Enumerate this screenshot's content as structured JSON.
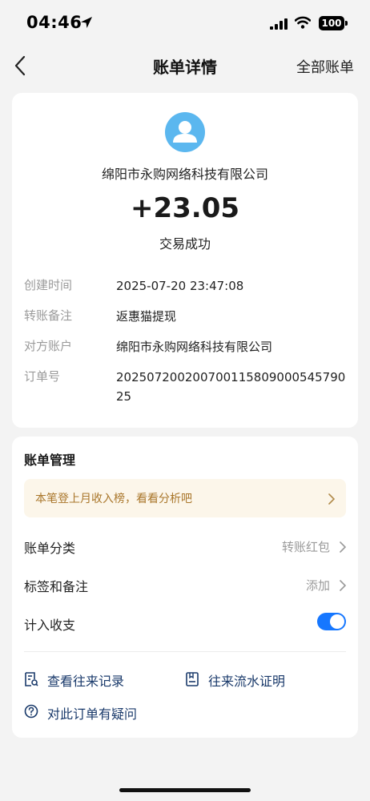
{
  "status_bar": {
    "time": "04:46",
    "battery": "100"
  },
  "nav": {
    "title": "账单详情",
    "right_label": "全部账单"
  },
  "summary": {
    "merchant": "绵阳市永购网络科技有限公司",
    "amount": "+23.05",
    "status": "交易成功"
  },
  "details": [
    {
      "label": "创建时间",
      "value": "2025-07-20 23:47:08"
    },
    {
      "label": "转账备注",
      "value": "返惠猫提现"
    },
    {
      "label": "对方账户",
      "value": "绵阳市永购网络科技有限公司"
    },
    {
      "label": "订单号",
      "value": "2025072002007001158090005457902​5"
    }
  ],
  "management": {
    "title": "账单管理",
    "promo": "本笔登上月收入榜，看看分析吧",
    "category": {
      "label": "账单分类",
      "value": "转账红包"
    },
    "tags": {
      "label": "标签和备注",
      "value": "添加"
    },
    "include": {
      "label": "计入收支",
      "enabled": true
    }
  },
  "links": {
    "history": "查看往来记录",
    "proof": "往来流水证明",
    "question": "对此订单有疑问"
  },
  "colors": {
    "accent": "#1677ff",
    "avatar": "#5bb7ef",
    "promo_bg": "#fcf6ea",
    "promo_text": "#a9762a",
    "link_text": "#1a3a6b"
  }
}
